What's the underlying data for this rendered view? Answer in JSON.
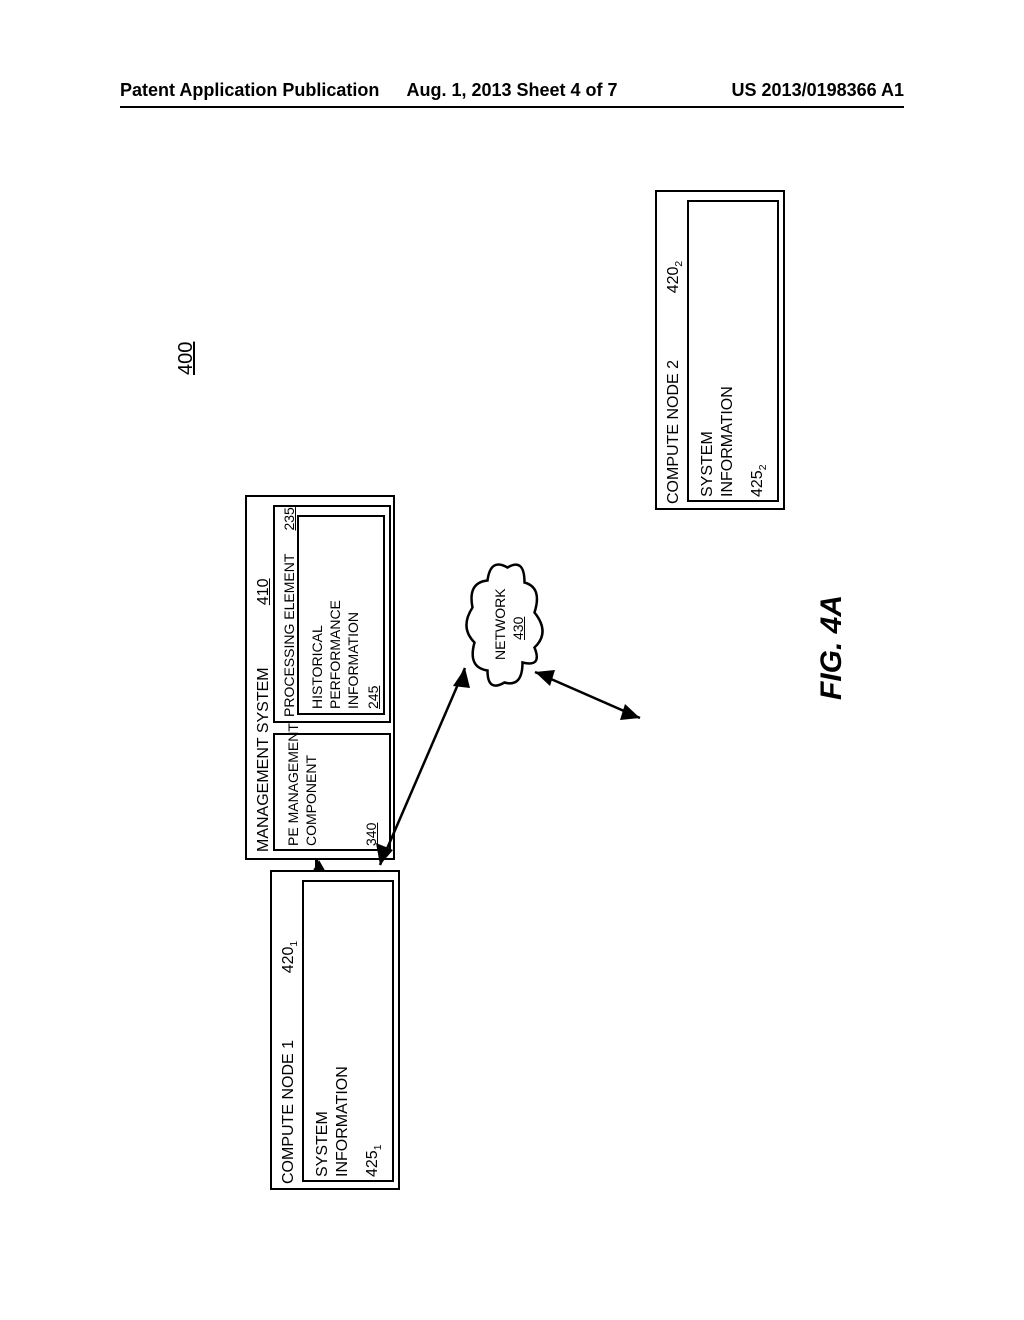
{
  "header": {
    "left": "Patent Application Publication",
    "center": "Aug. 1, 2013  Sheet 4 of 7",
    "right": "US 2013/0198366 A1"
  },
  "diagram_ref": "400",
  "mgmt": {
    "title": "MANAGEMENT SYSTEM",
    "ref": "410",
    "pe": {
      "title": "PROCESSING ELEMENT",
      "ref": "235",
      "hpi": {
        "line1": "HISTORICAL",
        "line2": "PERFORMANCE",
        "line3": "INFORMATION",
        "ref": "245"
      }
    },
    "pemc": {
      "line1": "PE MANAGEMENT",
      "line2": "COMPONENT",
      "ref": "340"
    }
  },
  "network": {
    "title": "NETWORK",
    "ref": "430"
  },
  "node1": {
    "title": "COMPUTE NODE 1",
    "ref_base": "420",
    "ref_sub": "1",
    "sys": {
      "line1": "SYSTEM",
      "line2": "INFORMATION",
      "ref_base": "425",
      "ref_sub": "1"
    }
  },
  "node2": {
    "title": "COMPUTE NODE 2",
    "ref_base": "420",
    "ref_sub": "2",
    "sys": {
      "line1": "SYSTEM",
      "line2": "INFORMATION",
      "ref_base": "425",
      "ref_sub": "2"
    }
  },
  "figure_caption": "FIG. 4A"
}
